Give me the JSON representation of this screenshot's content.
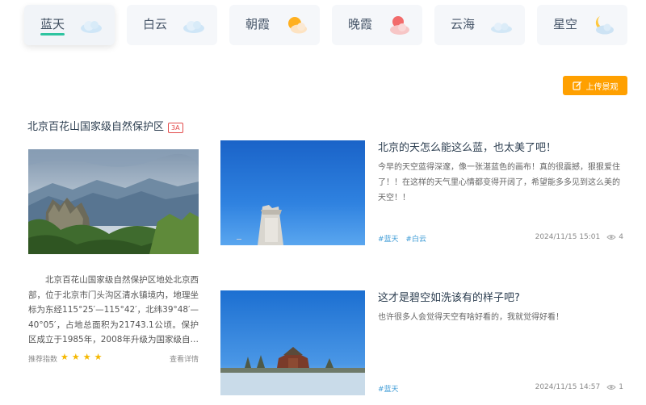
{
  "tabs": [
    {
      "label": "蓝天",
      "icon": "cloud-icon",
      "active": true
    },
    {
      "label": "白云",
      "icon": "cloud-icon",
      "active": false
    },
    {
      "label": "朝霞",
      "icon": "sun-cloud-icon",
      "active": false
    },
    {
      "label": "晚霞",
      "icon": "sunset-cloud-icon",
      "active": false
    },
    {
      "label": "云海",
      "icon": "cloud-icon",
      "active": false
    },
    {
      "label": "星空",
      "icon": "moon-cloud-icon",
      "active": false
    }
  ],
  "upload_button": {
    "label": "上传景观",
    "icon": "edit-icon"
  },
  "featured": {
    "title": "北京百花山国家级自然保护区",
    "badge": "3A",
    "description": "北京百花山国家级自然保护区地处北京西部，位于北京市门头沟区清水镇境内，地理坐标为东经115°25′—115°42′，北纬39°48′—40°05′，占地总面积为21743.1公顷。保护区成立于1985年，2008年升级为国家级自然保护区。",
    "rating_label": "推荐指数",
    "rating_stars": 4,
    "stars_text": "★★★★",
    "detail_link": "查看详情"
  },
  "posts": [
    {
      "title": "北京的天怎么能这么蓝，也太美了吧！",
      "text": "今早的天空蓝得深邃，像一张湛蓝色的画布！真的很震撼，狠狠爱住了！！在这样的天气里心情都变得开阔了，希望能多多见到这么美的天空！！",
      "tags": [
        "#蓝天",
        "#白云"
      ],
      "date": "2024/11/15 15:01",
      "views": "4"
    },
    {
      "title": "这才是碧空如洗该有的样子吧?",
      "text": "也许很多人会觉得天空有啥好看的，我就觉得好看！",
      "tags": [
        "#蓝天"
      ],
      "date": "2024/11/15 14:57",
      "views": "1"
    }
  ],
  "colors": {
    "accent": "#2ec4a0",
    "upload": "#ffa000",
    "tag": "#3d9bd6",
    "star": "#f5b800",
    "badge": "#e34b4b"
  }
}
